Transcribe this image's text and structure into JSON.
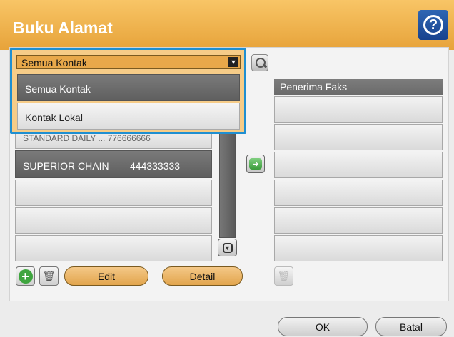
{
  "header": {
    "title": "Buku Alamat",
    "help_icon": "question-mark-icon"
  },
  "filter": {
    "selected": "Semua Kontak",
    "options": [
      "Semua Kontak",
      "Kontak Lokal"
    ]
  },
  "contacts": [
    {
      "text": "STANDARD DAILY ... 776666666"
    },
    {
      "name": "SUPERIOR CHAIN",
      "number": "444333333"
    }
  ],
  "recipients": {
    "header": "Penerima Faks"
  },
  "buttons": {
    "edit": "Edit",
    "detail": "Detail",
    "ok": "OK",
    "cancel": "Batal"
  },
  "colors": {
    "accent": "#e7a33a",
    "selection": "#1f8fd1",
    "help": "#17428e"
  }
}
